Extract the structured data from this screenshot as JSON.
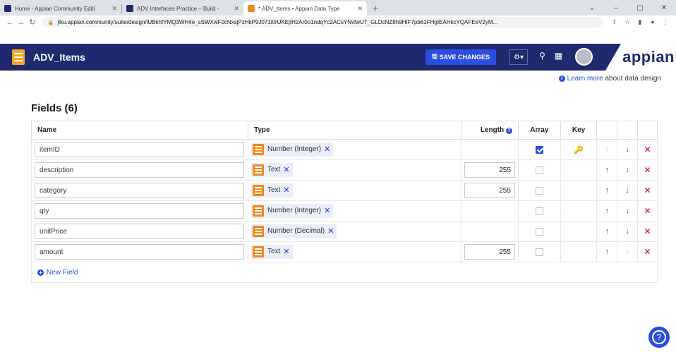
{
  "browser": {
    "tabs": [
      {
        "title": "Home - Appian Community Editi",
        "favicon_color": "#1f2a6e",
        "active": false
      },
      {
        "title": "ADV Interfaces Practice – Build -",
        "favicon_color": "#1f2a6e",
        "active": false
      },
      {
        "title": "* ADV_Items • Appian Data Type",
        "favicon_color": "#f08a1c",
        "active": true
      }
    ],
    "new_tab": "+",
    "url": "jlku.appian.community/suite/design/lUBkhfYMQ3WH4e_sSWXwF0cNxsjPzHkP9J071i0rUKEjIH2Ar0o1ndqYc2ACsYNvfwUT_GLDcNZ8h9HIF7pb61FHgIEAHkcYQAFEeV2yM...",
    "window_controls": {
      "chevron": "⌄",
      "minimize": "–",
      "restore": "▢",
      "close": "✕"
    }
  },
  "header": {
    "title": "ADV_Items",
    "save_label": "SAVE CHANGES",
    "brand": "appian",
    "colors": {
      "bar": "#1f2a6e",
      "accent": "#2a4ee0"
    }
  },
  "learn_more": {
    "link": "Learn more",
    "suffix": " about data design"
  },
  "fields_title": "Fields (6)",
  "columns": {
    "name": "Name",
    "type": "Type",
    "length": "Length",
    "array": "Array",
    "key": "Key"
  },
  "fields": [
    {
      "name": "itemID",
      "type": "Number (Integer)",
      "length": "",
      "array": true,
      "key": true,
      "up_enabled": false,
      "down_enabled": true
    },
    {
      "name": "description",
      "type": "Text",
      "length": "255",
      "array": false,
      "key": false,
      "up_enabled": true,
      "down_enabled": true
    },
    {
      "name": "category",
      "type": "Text",
      "length": "255",
      "array": false,
      "key": false,
      "up_enabled": true,
      "down_enabled": true
    },
    {
      "name": "qty",
      "type": "Number (Integer)",
      "length": "",
      "array": false,
      "key": false,
      "up_enabled": true,
      "down_enabled": true
    },
    {
      "name": "unitPrice",
      "type": "Number (Decimal)",
      "length": "",
      "array": false,
      "key": false,
      "up_enabled": true,
      "down_enabled": true
    },
    {
      "name": "amount",
      "type": "Text",
      "length": "255",
      "array": false,
      "key": false,
      "up_enabled": true,
      "down_enabled": false
    }
  ],
  "new_field_label": "New Field"
}
